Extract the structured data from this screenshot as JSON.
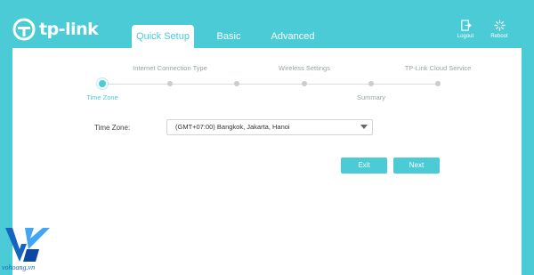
{
  "brand": {
    "name": "tp-link",
    "logo_icon": "tp-link-logo"
  },
  "nav": {
    "tabs": [
      {
        "label": "Quick Setup",
        "active": true
      },
      {
        "label": "Basic",
        "active": false
      },
      {
        "label": "Advanced",
        "active": false
      }
    ]
  },
  "header_actions": {
    "logout": {
      "label": "Logout",
      "icon": "logout-icon"
    },
    "reboot": {
      "label": "Reboot",
      "icon": "reboot-icon"
    }
  },
  "stepper": {
    "steps": [
      {
        "label": "Time Zone",
        "current": true
      },
      {
        "label": "Internet Connection Type",
        "current": false
      },
      {
        "label": "",
        "current": false
      },
      {
        "label": "Wireless Settings",
        "current": false
      },
      {
        "label": "Summary",
        "current": false
      },
      {
        "label": "TP-Link Cloud Service",
        "current": false
      }
    ]
  },
  "form": {
    "time_zone_label": "Time Zone:",
    "time_zone_value": "(GMT+07:00) Bangkok, Jakarta, Hanoi"
  },
  "buttons": {
    "exit": "Exit",
    "next": "Next"
  },
  "watermark": {
    "text": "vohoang.vn"
  },
  "colors": {
    "accent": "#4acbd6",
    "panel": "#ffffff",
    "muted": "#9aa5a8"
  }
}
